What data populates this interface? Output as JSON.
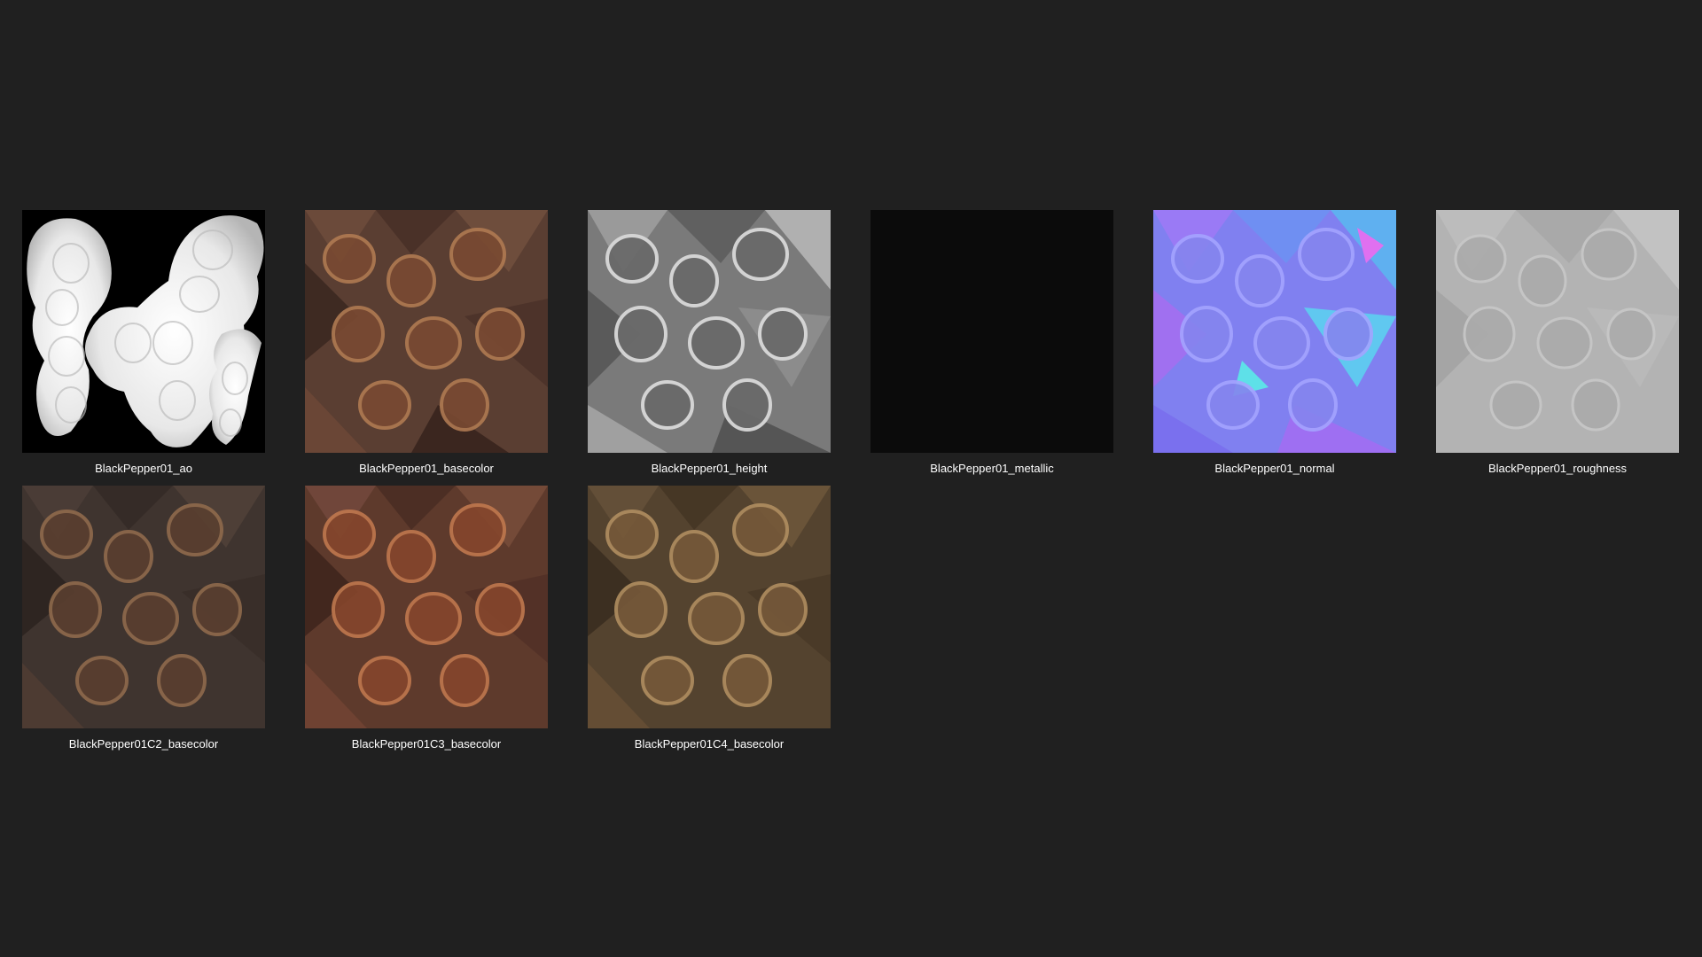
{
  "colors": {
    "background": "#202020",
    "label_text": "#ffffff"
  },
  "files": [
    {
      "name": "BlackPepper01_ao",
      "map": "ao"
    },
    {
      "name": "BlackPepper01_basecolor",
      "map": "basecolor"
    },
    {
      "name": "BlackPepper01_height",
      "map": "height"
    },
    {
      "name": "BlackPepper01_metallic",
      "map": "metallic"
    },
    {
      "name": "BlackPepper01_normal",
      "map": "normal"
    },
    {
      "name": "BlackPepper01_roughness",
      "map": "roughness"
    },
    {
      "name": "BlackPepper01C2_basecolor",
      "map": "basecolor-c2"
    },
    {
      "name": "BlackPepper01C3_basecolor",
      "map": "basecolor-c3"
    },
    {
      "name": "BlackPepper01C4_basecolor",
      "map": "basecolor-c4"
    }
  ]
}
